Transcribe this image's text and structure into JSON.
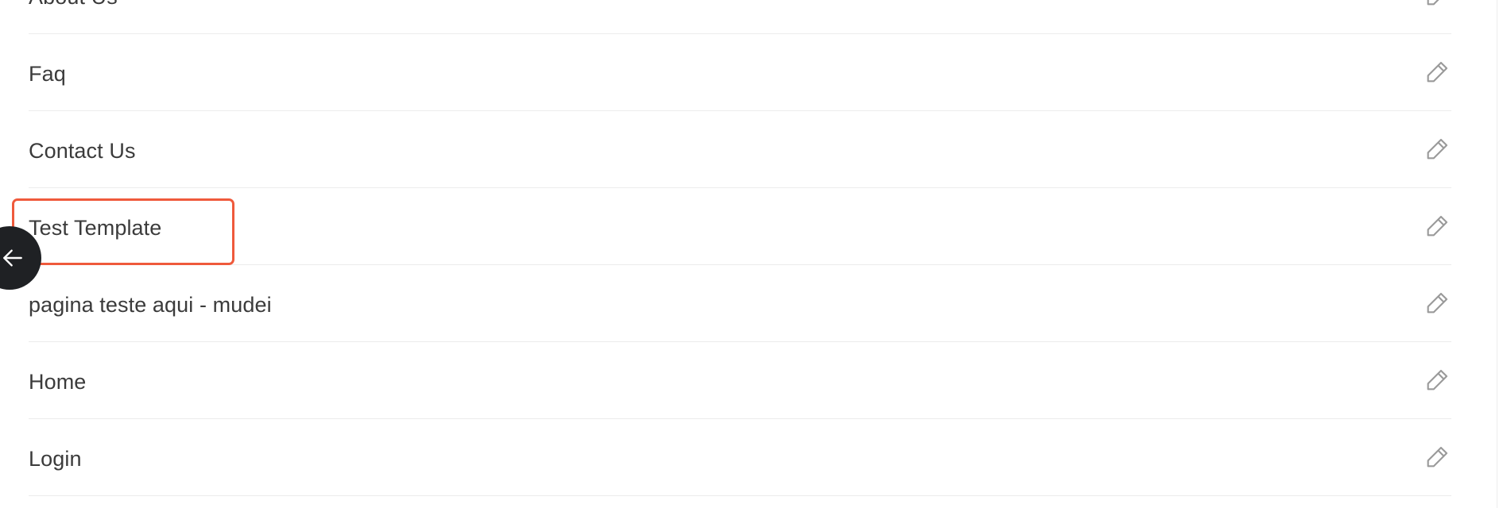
{
  "pages": [
    {
      "name": "About Us"
    },
    {
      "name": "Faq"
    },
    {
      "name": "Contact Us"
    },
    {
      "name": "Test Template"
    },
    {
      "name": "pagina teste aqui - mudei"
    },
    {
      "name": "Home"
    },
    {
      "name": "Login"
    }
  ],
  "icons": {
    "edit": "pencil-icon",
    "back": "arrow-left-icon"
  },
  "colors": {
    "highlight": "#ef5a3c",
    "back_button_bg": "#1f2124",
    "text": "#3b3b3b",
    "divider": "#ececec",
    "icon": "#9a9a9a"
  }
}
